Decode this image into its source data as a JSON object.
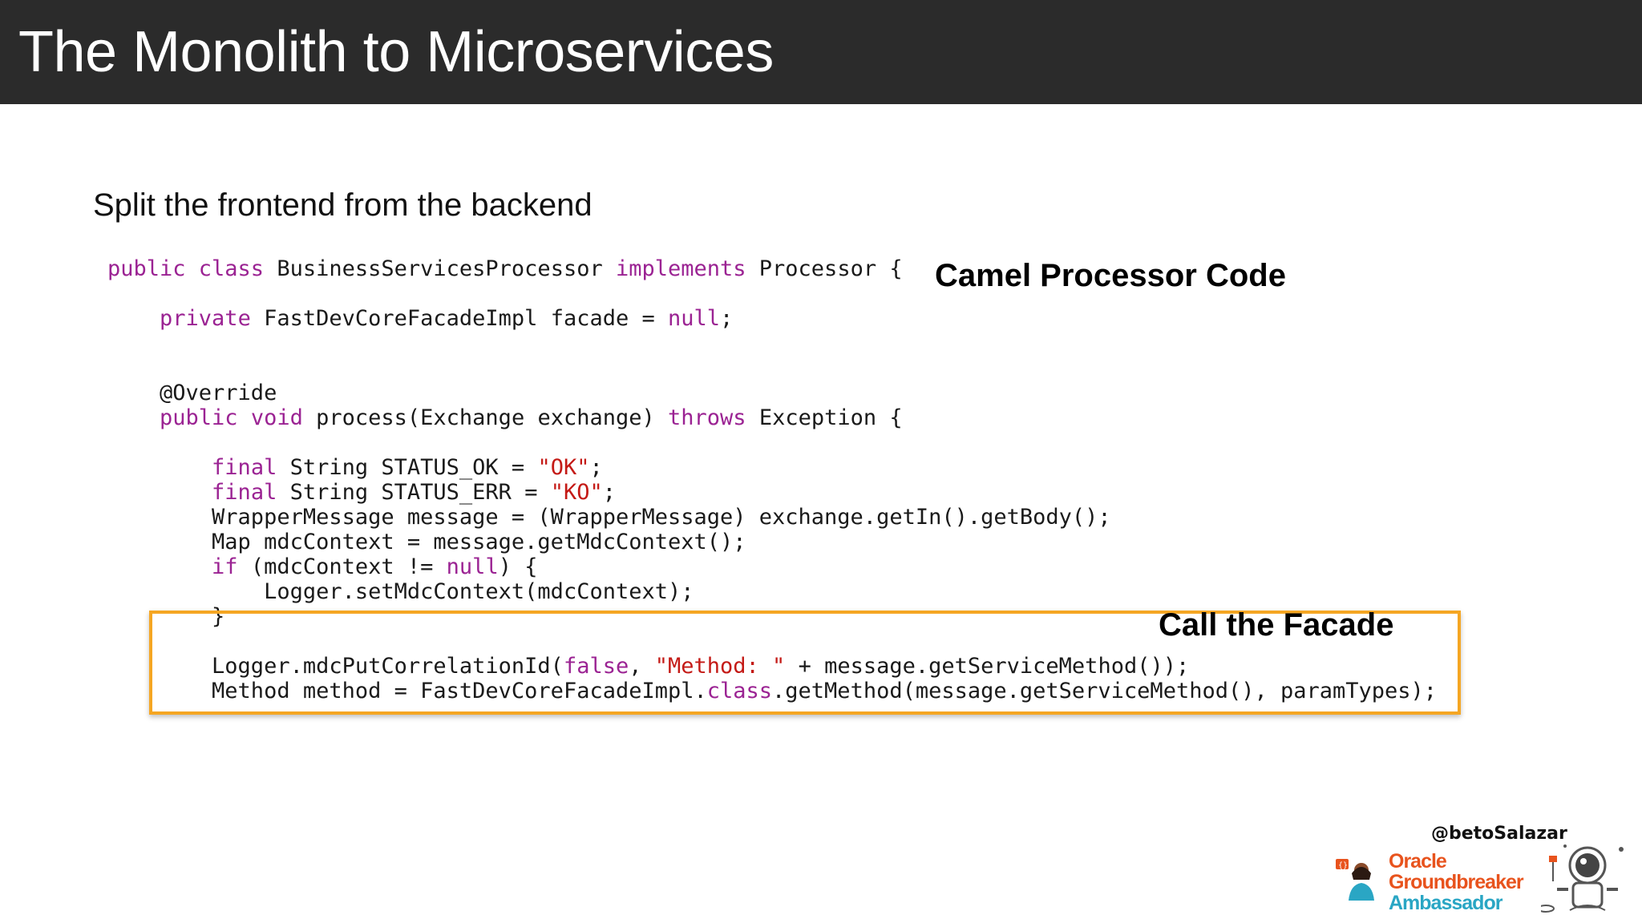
{
  "header": {
    "title": "The Monolith to Microservices"
  },
  "slide": {
    "subtitle": "Split the frontend from the backend",
    "annotation_top": "Camel Processor Code",
    "annotation_highlight": "Call the Facade"
  },
  "code": {
    "lines": [
      [
        {
          "t": "public class ",
          "c": "kw"
        },
        {
          "t": "BusinessServicesProcessor ",
          "c": ""
        },
        {
          "t": "implements ",
          "c": "kw"
        },
        {
          "t": "Processor {",
          "c": ""
        }
      ],
      [],
      [
        {
          "t": "    ",
          "c": ""
        },
        {
          "t": "private ",
          "c": "kw"
        },
        {
          "t": "FastDevCoreFacadeImpl facade = ",
          "c": ""
        },
        {
          "t": "null",
          "c": "kw"
        },
        {
          "t": ";",
          "c": ""
        }
      ],
      [],
      [],
      [
        {
          "t": "    @Override",
          "c": ""
        }
      ],
      [
        {
          "t": "    ",
          "c": ""
        },
        {
          "t": "public void ",
          "c": "kw"
        },
        {
          "t": "process(Exchange exchange) ",
          "c": ""
        },
        {
          "t": "throws ",
          "c": "kw"
        },
        {
          "t": "Exception {",
          "c": ""
        }
      ],
      [],
      [
        {
          "t": "        ",
          "c": ""
        },
        {
          "t": "final ",
          "c": "kw"
        },
        {
          "t": "String STATUS_OK = ",
          "c": ""
        },
        {
          "t": "\"OK\"",
          "c": "str"
        },
        {
          "t": ";",
          "c": ""
        }
      ],
      [
        {
          "t": "        ",
          "c": ""
        },
        {
          "t": "final ",
          "c": "kw"
        },
        {
          "t": "String STATUS_ERR = ",
          "c": ""
        },
        {
          "t": "\"KO\"",
          "c": "str"
        },
        {
          "t": ";",
          "c": ""
        }
      ],
      [
        {
          "t": "        WrapperMessage message = (WrapperMessage) exchange.getIn().getBody();",
          "c": ""
        }
      ],
      [
        {
          "t": "        Map mdcContext = message.getMdcContext();",
          "c": ""
        }
      ],
      [
        {
          "t": "        ",
          "c": ""
        },
        {
          "t": "if ",
          "c": "kw"
        },
        {
          "t": "(mdcContext != ",
          "c": ""
        },
        {
          "t": "null",
          "c": "kw"
        },
        {
          "t": ") {",
          "c": ""
        }
      ],
      [
        {
          "t": "            Logger.setMdcContext(mdcContext);",
          "c": ""
        }
      ],
      [
        {
          "t": "        }",
          "c": ""
        }
      ],
      [],
      [
        {
          "t": "        Logger.mdcPutCorrelationId(",
          "c": ""
        },
        {
          "t": "false",
          "c": "kw"
        },
        {
          "t": ", ",
          "c": ""
        },
        {
          "t": "\"Method: \"",
          "c": "str"
        },
        {
          "t": " + message.getServiceMethod());",
          "c": ""
        }
      ],
      [
        {
          "t": "        Method method = FastDevCoreFacadeImpl.",
          "c": ""
        },
        {
          "t": "class",
          "c": "kw"
        },
        {
          "t": ".getMethod(message.getServiceMethod(), paramTypes);",
          "c": ""
        }
      ]
    ]
  },
  "footer": {
    "handle": "@betoSalazar",
    "badge_line1": "Oracle",
    "badge_line2": "Groundbreaker",
    "badge_line3": "Ambassador",
    "badge_colors": {
      "orange": "#e8531d",
      "teal": "#2aa6c4"
    }
  }
}
